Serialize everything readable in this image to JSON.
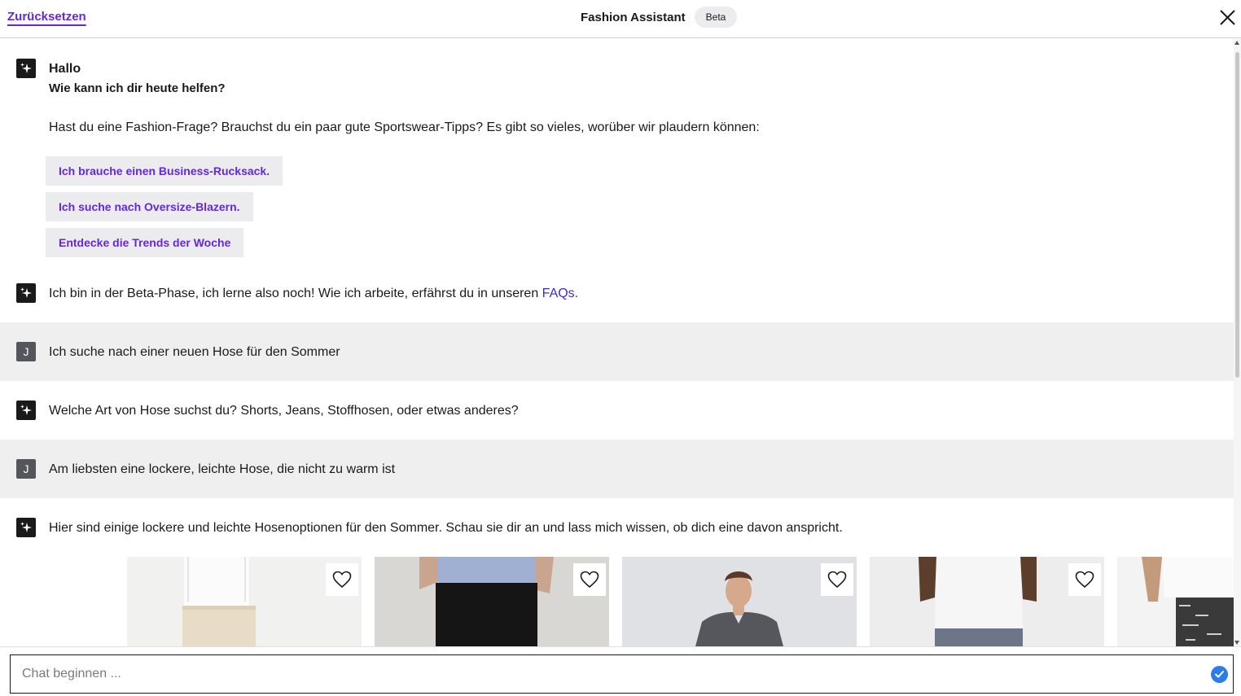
{
  "header": {
    "reset_label": "Zurücksetzen",
    "title": "Fashion Assistant",
    "badge": "Beta"
  },
  "messages": {
    "greeting_line1": "Hallo",
    "greeting_line2": "Wie kann ich dir heute helfen?",
    "intro": "Hast du eine Fashion-Frage? Brauchst du ein paar gute Sportswear-Tipps? Es gibt so vieles, worüber wir plaudern können:",
    "suggestions": [
      "Ich brauche einen Business-Rucksack.",
      "Ich suche nach Oversize-Blazern.",
      "Entdecke die Trends der Woche"
    ],
    "beta_notice": "Ich bin in der Beta-Phase, ich lerne also noch! Wie ich arbeite, erfährst du in unseren ",
    "faq_link": "FAQs.",
    "user_initial": "J",
    "user_msg_1": "Ich suche nach einer neuen Hose für den Sommer",
    "ai_msg_1": "Welche Art von Hose suchst du? Shorts, Jeans, Stoffhosen, oder etwas anderes?",
    "user_msg_2": "Am liebsten eine lockere, leichte Hose, die nicht zu warm ist",
    "ai_msg_2": "Hier sind einige lockere und leichte Hosenoptionen für den Sommer. Schau sie dir an und lass mich wissen, ob dich eine davon anspricht."
  },
  "products": [
    {
      "name": "product-beige-trousers",
      "fav_icon": "heart-icon"
    },
    {
      "name": "product-black-trousers",
      "fav_icon": "heart-icon"
    },
    {
      "name": "product-grey-tshirt-model",
      "fav_icon": "heart-icon"
    },
    {
      "name": "product-grey-shorts",
      "fav_icon": "heart-icon"
    },
    {
      "name": "product-tweed-shorts",
      "fav_icon": "heart-icon"
    }
  ],
  "input": {
    "placeholder": "Chat beginnen ..."
  },
  "colors": {
    "accent": "#6328e0",
    "link": "#3b2bd0",
    "user_row_bg": "#efeff0",
    "send_button": "#2b7de9"
  }
}
